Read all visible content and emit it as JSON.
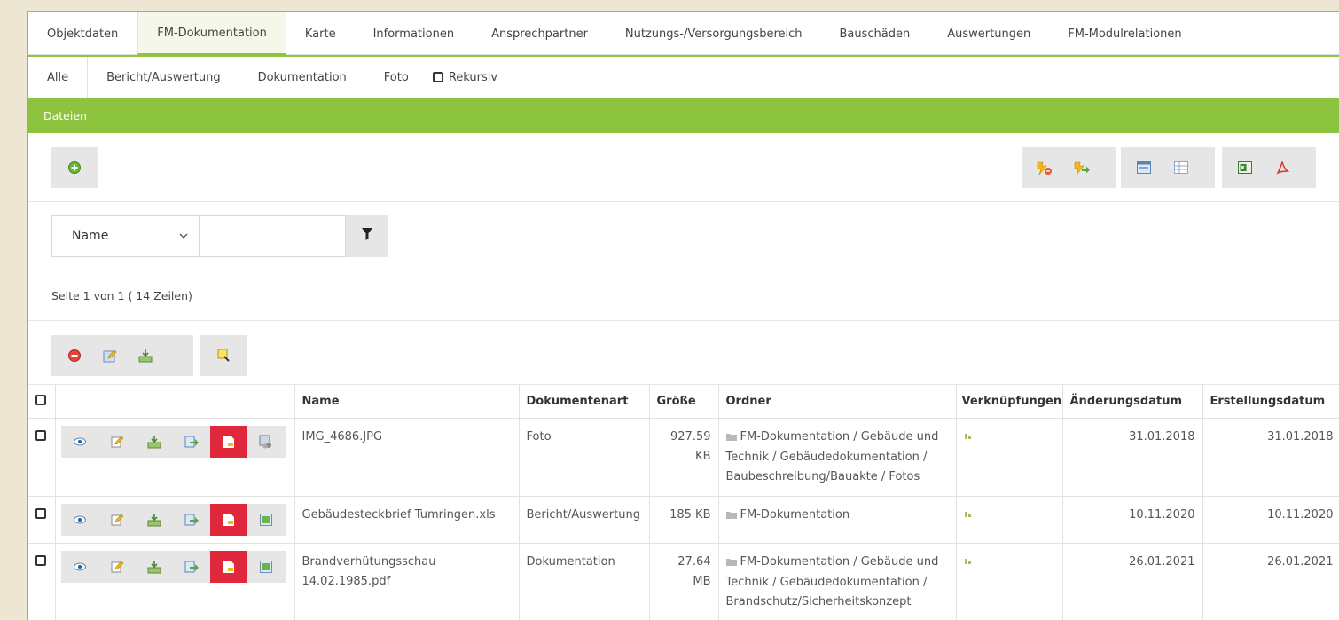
{
  "tabs_main": [
    {
      "label": "Objektdaten"
    },
    {
      "label": "FM-Dokumentation"
    },
    {
      "label": "Karte"
    },
    {
      "label": "Informationen"
    },
    {
      "label": "Ansprechpartner"
    },
    {
      "label": "Nutzungs-/Versorgungsbereich"
    },
    {
      "label": "Bauschäden"
    },
    {
      "label": "Auswertungen"
    },
    {
      "label": "FM-Modulrelationen"
    }
  ],
  "tabs_sub": [
    {
      "label": "Alle"
    },
    {
      "label": "Bericht/Auswertung"
    },
    {
      "label": "Dokumentation"
    },
    {
      "label": "Foto"
    }
  ],
  "rekursiv_label": "Rekursiv",
  "section_title": "Dateien",
  "filter": {
    "field_selected": "Name",
    "value": ""
  },
  "paging": "Seite 1 von 1 ( 14 Zeilen)",
  "table": {
    "headers": {
      "name": "Name",
      "art": "Dokumentenart",
      "size": "Größe",
      "folder": "Ordner",
      "links": "Verknüpfungen",
      "changed": "Änderungsdatum",
      "created": "Erstellungsdatum"
    },
    "rows": [
      {
        "name": "IMG_4686.JPG",
        "art": "Foto",
        "size": "927.59 KB",
        "folder": "FM-Dokumentation / Gebäude und Technik / Gebäudedokumentation / Baubeschreibung/Bauakte / Fotos",
        "changed": "31.01.2018",
        "created": "31.01.2018"
      },
      {
        "name": "Gebäudesteckbrief Tumringen.xls",
        "art": "Bericht/Auswertung",
        "size": "185 KB",
        "folder": "FM-Dokumentation",
        "changed": "10.11.2020",
        "created": "10.11.2020"
      },
      {
        "name": "Brandverhütungsschau 14.02.1985.pdf",
        "art": "Dokumentation",
        "size": "27.64 MB",
        "folder": "FM-Dokumentation / Gebäude und Technik / Gebäudedokumentation / Brandschutz/Sicherheitskonzept",
        "changed": "26.01.2021",
        "created": "26.01.2021"
      }
    ]
  },
  "colors": {
    "accent": "#8dc43f",
    "danger": "#e0283c",
    "toolbar_bg": "#e6e6e6"
  }
}
